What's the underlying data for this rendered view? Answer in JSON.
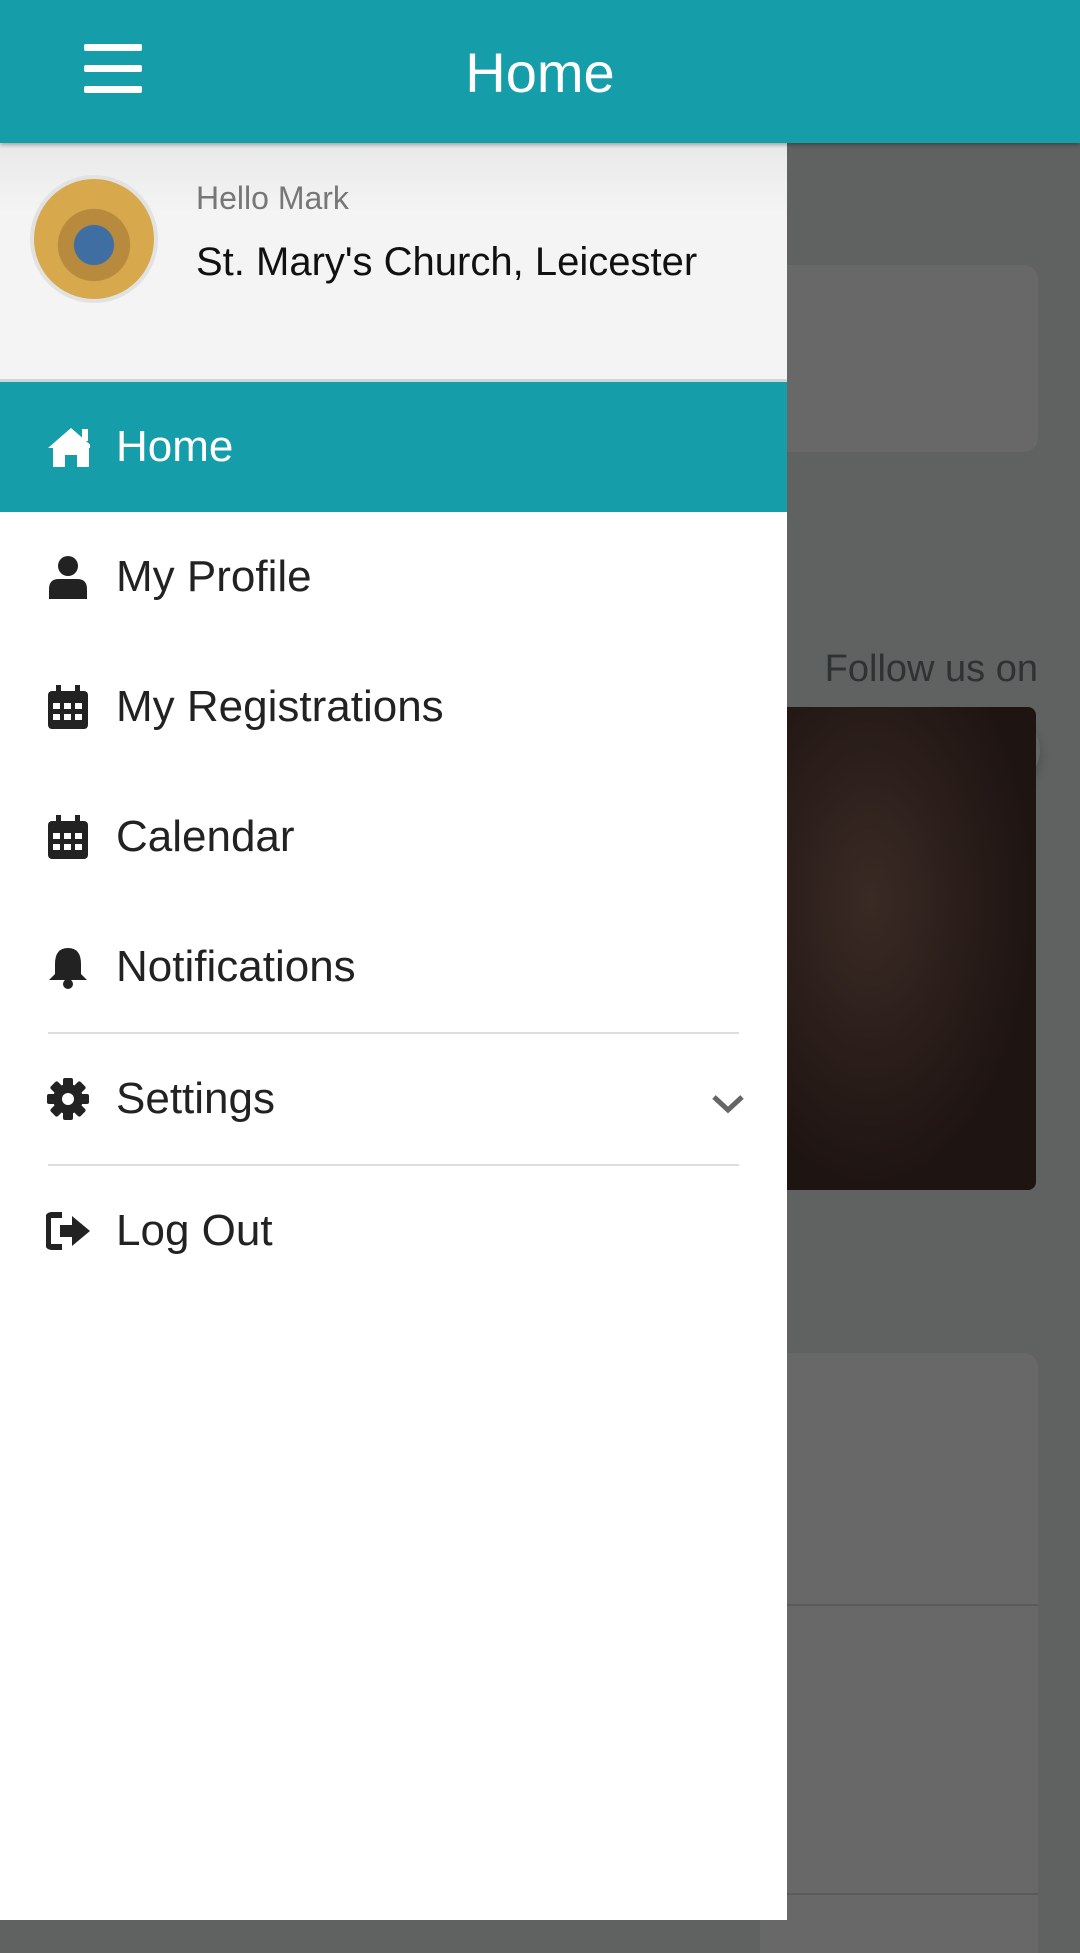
{
  "header": {
    "title": "Home",
    "menu_icon": "hamburger-icon"
  },
  "drawer": {
    "greeting": "Hello Mark",
    "church": "St. Mary's Church, Leicester",
    "items": [
      {
        "label": "Home",
        "icon": "home-icon",
        "active": true
      },
      {
        "label": "My Profile",
        "icon": "user-icon"
      },
      {
        "label": "My Registrations",
        "icon": "calendar-icon"
      },
      {
        "label": "Calendar",
        "icon": "calendar-icon"
      },
      {
        "label": "Notifications",
        "icon": "bell-icon"
      },
      {
        "label": "Settings",
        "icon": "gear-icon",
        "expandable": true
      },
      {
        "label": "Log Out",
        "icon": "logout-icon"
      }
    ]
  },
  "background": {
    "follow_text": "Follow us on",
    "social": [
      "youtube-icon",
      "soundcloud-icon",
      "globe-icon"
    ]
  },
  "colors": {
    "accent": "#159eaa",
    "overlay": "#606262",
    "social_icon": "#0d5a62"
  }
}
